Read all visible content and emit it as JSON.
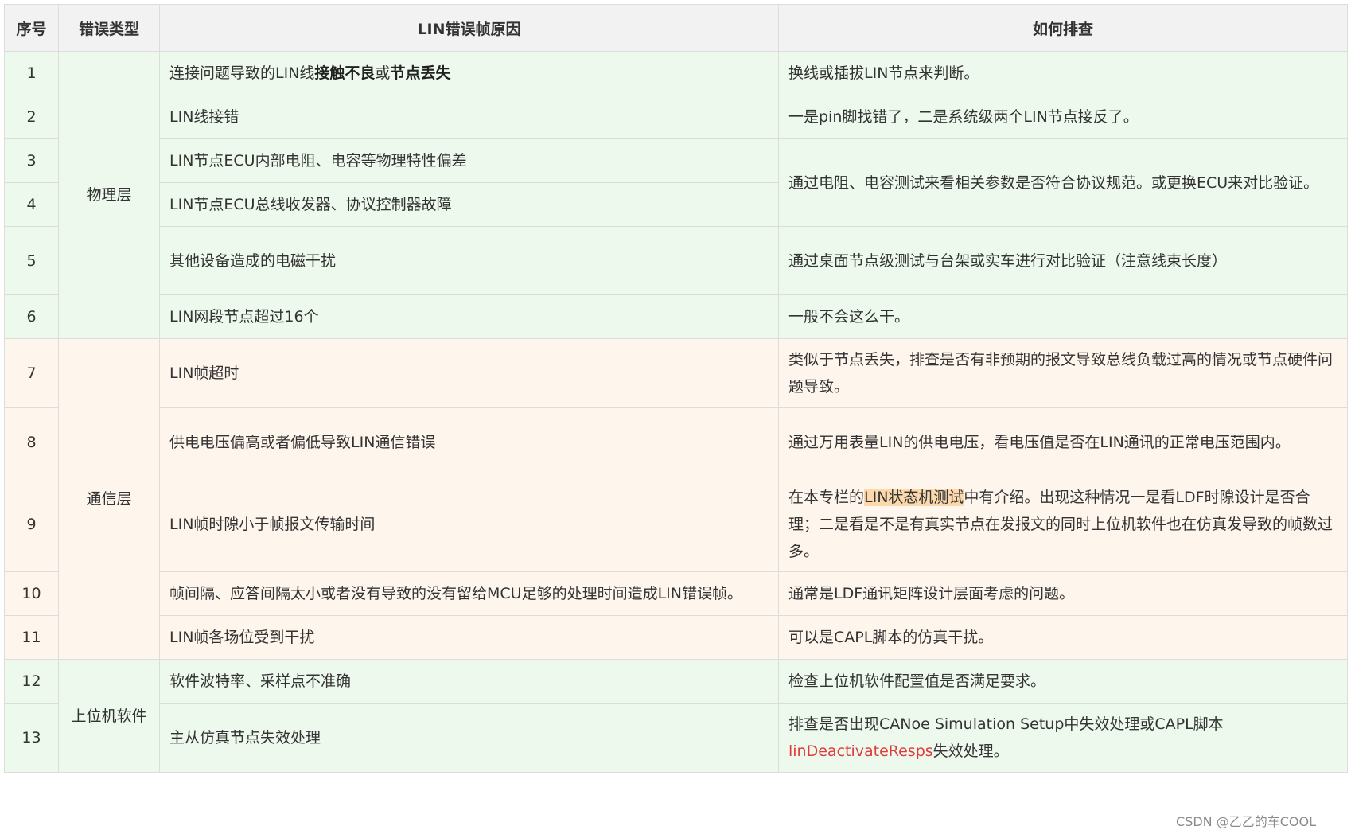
{
  "headers": {
    "num": "序号",
    "type": "错误类型",
    "cause": "LIN错误帧原因",
    "check": "如何排查"
  },
  "categories": {
    "physical": "物理层",
    "comm": "通信层",
    "host": "上位机软件"
  },
  "rows": [
    {
      "num": "1",
      "cause_p1": "连接问题导致的LIN线",
      "cause_b1": "接触不良",
      "cause_p2": "或",
      "cause_b2": "节点丢失",
      "check": "换线或插拔LIN节点来判断。"
    },
    {
      "num": "2",
      "cause": "LIN线接错",
      "check": "一是pin脚找错了，二是系统级两个LIN节点接反了。"
    },
    {
      "num": "3",
      "cause": "LIN节点ECU内部电阻、电容等物理特性偏差",
      "check": "通过电阻、电容测试来看相关参数是否符合协议规范。或更换ECU来对比验证。"
    },
    {
      "num": "4",
      "cause": "LIN节点ECU总线收发器、协议控制器故障"
    },
    {
      "num": "5",
      "cause": "其他设备造成的电磁干扰",
      "check": "通过桌面节点级测试与台架或实车进行对比验证（注意线束长度）"
    },
    {
      "num": "6",
      "cause": "LIN网段节点超过16个",
      "check": "一般不会这么干。"
    },
    {
      "num": "7",
      "cause": "LIN帧超时",
      "check": "类似于节点丢失，排查是否有非预期的报文导致总线负载过高的情况或节点硬件问题导致。"
    },
    {
      "num": "8",
      "cause": "供电电压偏高或者偏低导致LIN通信错误",
      "check": "通过万用表量LIN的供电电压，看电压值是否在LIN通讯的正常电压范围内。"
    },
    {
      "num": "9",
      "cause": "LIN帧时隙小于帧报文传输时间",
      "check_pre": "在本专栏的",
      "check_hl": "LIN状态机测试",
      "check_post": "中有介绍。出现这种情况一是看LDF时隙设计是否合理；二是看是不是有真实节点在发报文的同时上位机软件也在仿真发导致的帧数过多。"
    },
    {
      "num": "10",
      "cause": "帧间隔、应答间隔太小或者没有导致的没有留给MCU足够的处理时间造成LIN错误帧。",
      "check": "通常是LDF通讯矩阵设计层面考虑的问题。"
    },
    {
      "num": "11",
      "cause": "LIN帧各场位受到干扰",
      "check": "可以是CAPL脚本的仿真干扰。"
    },
    {
      "num": "12",
      "cause": "软件波特率、采样点不准确",
      "check": "检查上位机软件配置值是否满足要求。"
    },
    {
      "num": "13",
      "cause": "主从仿真节点失效处理",
      "check_pre": "排查是否出现CANoe Simulation Setup中失效处理或CAPL脚本",
      "check_red": "linDeactivateResps",
      "check_post": "失效处理。"
    }
  ],
  "watermark": "CSDN @乙乙的车COOL",
  "colors": {
    "header_bg": "#f2f2f2",
    "green_row": "#eef9ee",
    "orange_row": "#fef5ec",
    "highlight": "#fbd9ac",
    "red_text": "#e03b3b",
    "border": "#dcdcdc"
  }
}
